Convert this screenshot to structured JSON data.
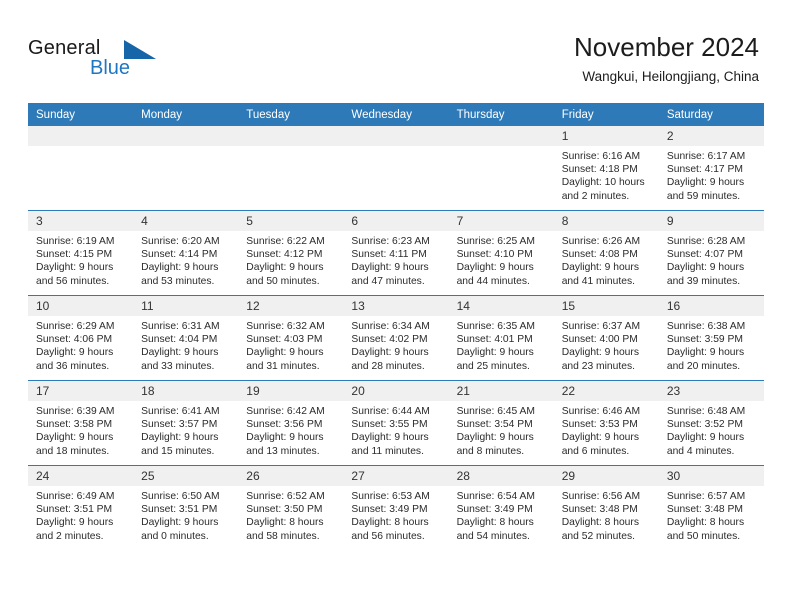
{
  "brand": {
    "name_part1": "General",
    "name_part2": "Blue"
  },
  "header": {
    "title": "November 2024",
    "subtitle": "Wangkui, Heilongjiang, China"
  },
  "colors": {
    "header_blue": "#2e7ab8",
    "logo_blue": "#1f77c2",
    "daynum_band": "#f0f0f0"
  },
  "weekdays": [
    "Sunday",
    "Monday",
    "Tuesday",
    "Wednesday",
    "Thursday",
    "Friday",
    "Saturday"
  ],
  "weeks": [
    [
      {
        "day": "",
        "sunrise": "",
        "sunset": "",
        "daylight": "",
        "empty": true
      },
      {
        "day": "",
        "sunrise": "",
        "sunset": "",
        "daylight": "",
        "empty": true
      },
      {
        "day": "",
        "sunrise": "",
        "sunset": "",
        "daylight": "",
        "empty": true
      },
      {
        "day": "",
        "sunrise": "",
        "sunset": "",
        "daylight": "",
        "empty": true
      },
      {
        "day": "",
        "sunrise": "",
        "sunset": "",
        "daylight": "",
        "empty": true
      },
      {
        "day": "1",
        "sunrise": "Sunrise: 6:16 AM",
        "sunset": "Sunset: 4:18 PM",
        "daylight": "Daylight: 10 hours and 2 minutes."
      },
      {
        "day": "2",
        "sunrise": "Sunrise: 6:17 AM",
        "sunset": "Sunset: 4:17 PM",
        "daylight": "Daylight: 9 hours and 59 minutes."
      }
    ],
    [
      {
        "day": "3",
        "sunrise": "Sunrise: 6:19 AM",
        "sunset": "Sunset: 4:15 PM",
        "daylight": "Daylight: 9 hours and 56 minutes."
      },
      {
        "day": "4",
        "sunrise": "Sunrise: 6:20 AM",
        "sunset": "Sunset: 4:14 PM",
        "daylight": "Daylight: 9 hours and 53 minutes."
      },
      {
        "day": "5",
        "sunrise": "Sunrise: 6:22 AM",
        "sunset": "Sunset: 4:12 PM",
        "daylight": "Daylight: 9 hours and 50 minutes."
      },
      {
        "day": "6",
        "sunrise": "Sunrise: 6:23 AM",
        "sunset": "Sunset: 4:11 PM",
        "daylight": "Daylight: 9 hours and 47 minutes."
      },
      {
        "day": "7",
        "sunrise": "Sunrise: 6:25 AM",
        "sunset": "Sunset: 4:10 PM",
        "daylight": "Daylight: 9 hours and 44 minutes."
      },
      {
        "day": "8",
        "sunrise": "Sunrise: 6:26 AM",
        "sunset": "Sunset: 4:08 PM",
        "daylight": "Daylight: 9 hours and 41 minutes."
      },
      {
        "day": "9",
        "sunrise": "Sunrise: 6:28 AM",
        "sunset": "Sunset: 4:07 PM",
        "daylight": "Daylight: 9 hours and 39 minutes."
      }
    ],
    [
      {
        "day": "10",
        "sunrise": "Sunrise: 6:29 AM",
        "sunset": "Sunset: 4:06 PM",
        "daylight": "Daylight: 9 hours and 36 minutes."
      },
      {
        "day": "11",
        "sunrise": "Sunrise: 6:31 AM",
        "sunset": "Sunset: 4:04 PM",
        "daylight": "Daylight: 9 hours and 33 minutes."
      },
      {
        "day": "12",
        "sunrise": "Sunrise: 6:32 AM",
        "sunset": "Sunset: 4:03 PM",
        "daylight": "Daylight: 9 hours and 31 minutes."
      },
      {
        "day": "13",
        "sunrise": "Sunrise: 6:34 AM",
        "sunset": "Sunset: 4:02 PM",
        "daylight": "Daylight: 9 hours and 28 minutes."
      },
      {
        "day": "14",
        "sunrise": "Sunrise: 6:35 AM",
        "sunset": "Sunset: 4:01 PM",
        "daylight": "Daylight: 9 hours and 25 minutes."
      },
      {
        "day": "15",
        "sunrise": "Sunrise: 6:37 AM",
        "sunset": "Sunset: 4:00 PM",
        "daylight": "Daylight: 9 hours and 23 minutes."
      },
      {
        "day": "16",
        "sunrise": "Sunrise: 6:38 AM",
        "sunset": "Sunset: 3:59 PM",
        "daylight": "Daylight: 9 hours and 20 minutes."
      }
    ],
    [
      {
        "day": "17",
        "sunrise": "Sunrise: 6:39 AM",
        "sunset": "Sunset: 3:58 PM",
        "daylight": "Daylight: 9 hours and 18 minutes."
      },
      {
        "day": "18",
        "sunrise": "Sunrise: 6:41 AM",
        "sunset": "Sunset: 3:57 PM",
        "daylight": "Daylight: 9 hours and 15 minutes."
      },
      {
        "day": "19",
        "sunrise": "Sunrise: 6:42 AM",
        "sunset": "Sunset: 3:56 PM",
        "daylight": "Daylight: 9 hours and 13 minutes."
      },
      {
        "day": "20",
        "sunrise": "Sunrise: 6:44 AM",
        "sunset": "Sunset: 3:55 PM",
        "daylight": "Daylight: 9 hours and 11 minutes."
      },
      {
        "day": "21",
        "sunrise": "Sunrise: 6:45 AM",
        "sunset": "Sunset: 3:54 PM",
        "daylight": "Daylight: 9 hours and 8 minutes."
      },
      {
        "day": "22",
        "sunrise": "Sunrise: 6:46 AM",
        "sunset": "Sunset: 3:53 PM",
        "daylight": "Daylight: 9 hours and 6 minutes."
      },
      {
        "day": "23",
        "sunrise": "Sunrise: 6:48 AM",
        "sunset": "Sunset: 3:52 PM",
        "daylight": "Daylight: 9 hours and 4 minutes."
      }
    ],
    [
      {
        "day": "24",
        "sunrise": "Sunrise: 6:49 AM",
        "sunset": "Sunset: 3:51 PM",
        "daylight": "Daylight: 9 hours and 2 minutes."
      },
      {
        "day": "25",
        "sunrise": "Sunrise: 6:50 AM",
        "sunset": "Sunset: 3:51 PM",
        "daylight": "Daylight: 9 hours and 0 minutes."
      },
      {
        "day": "26",
        "sunrise": "Sunrise: 6:52 AM",
        "sunset": "Sunset: 3:50 PM",
        "daylight": "Daylight: 8 hours and 58 minutes."
      },
      {
        "day": "27",
        "sunrise": "Sunrise: 6:53 AM",
        "sunset": "Sunset: 3:49 PM",
        "daylight": "Daylight: 8 hours and 56 minutes."
      },
      {
        "day": "28",
        "sunrise": "Sunrise: 6:54 AM",
        "sunset": "Sunset: 3:49 PM",
        "daylight": "Daylight: 8 hours and 54 minutes."
      },
      {
        "day": "29",
        "sunrise": "Sunrise: 6:56 AM",
        "sunset": "Sunset: 3:48 PM",
        "daylight": "Daylight: 8 hours and 52 minutes."
      },
      {
        "day": "30",
        "sunrise": "Sunrise: 6:57 AM",
        "sunset": "Sunset: 3:48 PM",
        "daylight": "Daylight: 8 hours and 50 minutes."
      }
    ]
  ]
}
